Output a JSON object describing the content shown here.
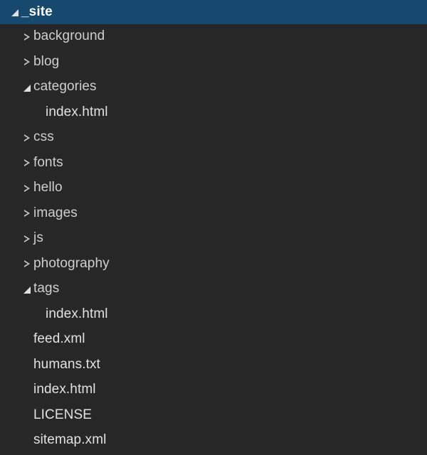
{
  "tree": {
    "root_label": "_site",
    "root_state": "expanded",
    "root_selected": true,
    "items": [
      {
        "label": "_site",
        "type": "folder",
        "state": "expanded",
        "depth": 0,
        "selected": true,
        "icon": "triangle-down-icon"
      },
      {
        "label": "background",
        "type": "folder",
        "state": "collapsed",
        "depth": 1,
        "selected": false,
        "icon": "triangle-right-icon"
      },
      {
        "label": "blog",
        "type": "folder",
        "state": "collapsed",
        "depth": 1,
        "selected": false,
        "icon": "triangle-right-icon"
      },
      {
        "label": "categories",
        "type": "folder",
        "state": "expanded",
        "depth": 1,
        "selected": false,
        "icon": "triangle-down-icon"
      },
      {
        "label": "index.html",
        "type": "file",
        "state": "none",
        "depth": 2,
        "selected": false,
        "icon": ""
      },
      {
        "label": "css",
        "type": "folder",
        "state": "collapsed",
        "depth": 1,
        "selected": false,
        "icon": "triangle-right-icon"
      },
      {
        "label": "fonts",
        "type": "folder",
        "state": "collapsed",
        "depth": 1,
        "selected": false,
        "icon": "triangle-right-icon"
      },
      {
        "label": "hello",
        "type": "folder",
        "state": "collapsed",
        "depth": 1,
        "selected": false,
        "icon": "triangle-right-icon"
      },
      {
        "label": "images",
        "type": "folder",
        "state": "collapsed",
        "depth": 1,
        "selected": false,
        "icon": "triangle-right-icon"
      },
      {
        "label": "js",
        "type": "folder",
        "state": "collapsed",
        "depth": 1,
        "selected": false,
        "icon": "triangle-right-icon"
      },
      {
        "label": "photography",
        "type": "folder",
        "state": "collapsed",
        "depth": 1,
        "selected": false,
        "icon": "triangle-right-icon"
      },
      {
        "label": "tags",
        "type": "folder",
        "state": "expanded",
        "depth": 1,
        "selected": false,
        "icon": "triangle-down-icon"
      },
      {
        "label": "index.html",
        "type": "file",
        "state": "none",
        "depth": 2,
        "selected": false,
        "icon": ""
      },
      {
        "label": "feed.xml",
        "type": "file",
        "state": "none",
        "depth": 1,
        "selected": false,
        "icon": ""
      },
      {
        "label": "humans.txt",
        "type": "file",
        "state": "none",
        "depth": 1,
        "selected": false,
        "icon": ""
      },
      {
        "label": "index.html",
        "type": "file",
        "state": "none",
        "depth": 1,
        "selected": false,
        "icon": ""
      },
      {
        "label": "LICENSE",
        "type": "file",
        "state": "none",
        "depth": 1,
        "selected": false,
        "icon": ""
      },
      {
        "label": "sitemap.xml",
        "type": "file",
        "state": "none",
        "depth": 1,
        "selected": false,
        "icon": ""
      }
    ]
  },
  "colors": {
    "background": "#272727",
    "selected_row": "#17496f",
    "folder_text": "#cfcfcf",
    "file_text": "#e2e2e2",
    "selected_text": "#ffffff",
    "twisty": "#c8c8c8"
  }
}
